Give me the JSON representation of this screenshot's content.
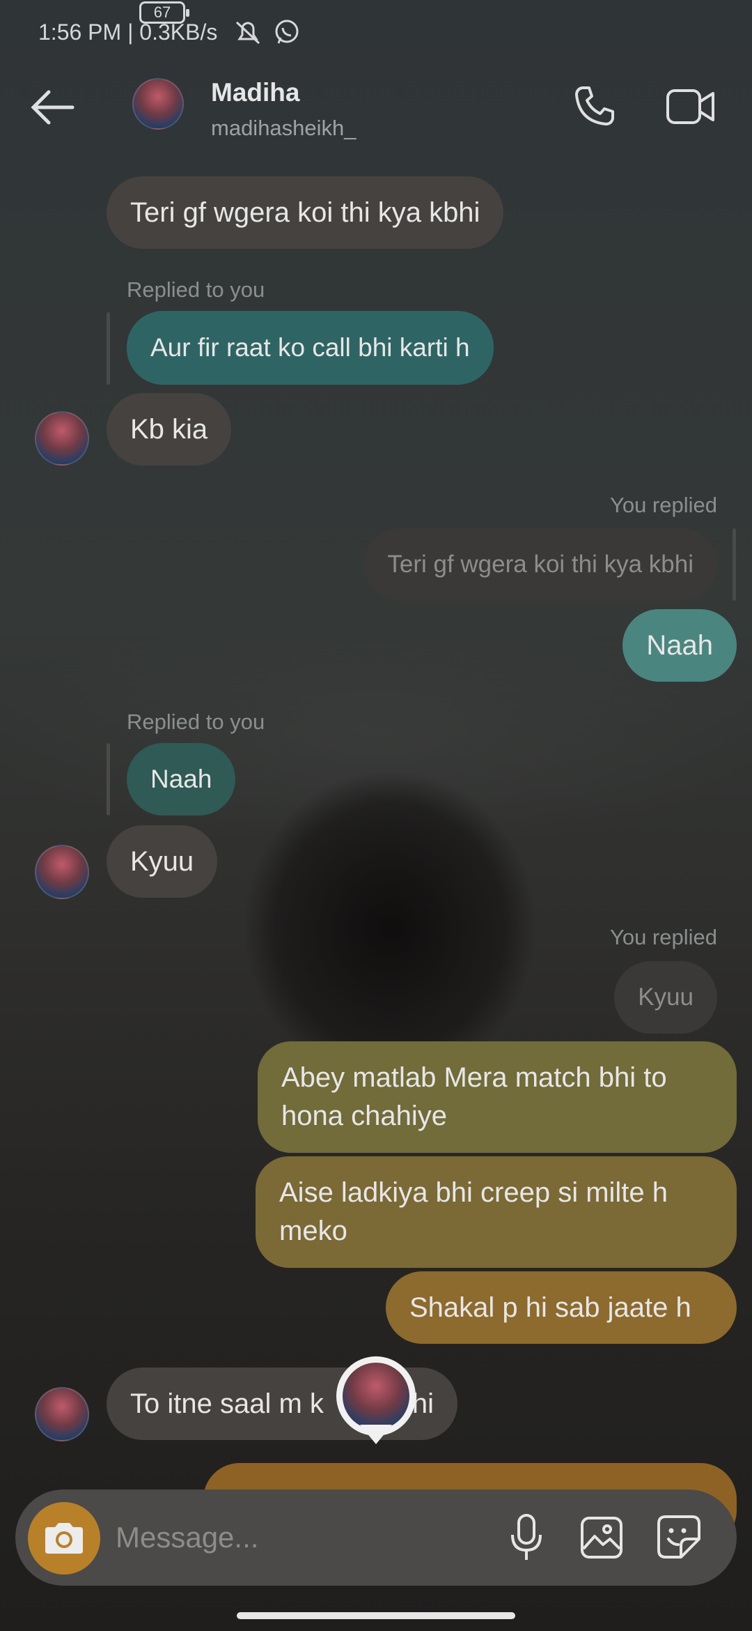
{
  "status_bar": {
    "time_speed": "1:56 PM | 0.3KB/s",
    "battery": "67"
  },
  "header": {
    "name": "Madiha",
    "username": "madihasheikh_"
  },
  "messages": [
    {
      "text": "Teri gf wgera koi thi kya kbhi"
    },
    {
      "meta": "Replied to you",
      "text": "Aur fir raat ko call bhi karti h"
    },
    {
      "text": "Kb kia"
    },
    {
      "meta": "You replied",
      "quoted": "Teri gf wgera koi thi kya kbhi"
    },
    {
      "text": "Naah"
    },
    {
      "meta": "Replied to you",
      "text": "Naah"
    },
    {
      "text": "Kyuu"
    },
    {
      "meta": "You replied",
      "quoted": "Kyuu"
    },
    {
      "text": "Abey matlab Mera match bhi to hona chahiye"
    },
    {
      "text": "Aise ladkiya bhi creep si milte h meko"
    },
    {
      "text": "Shakal p hi sab jaate h"
    },
    {
      "text": "To itne saal m k",
      "text_end": "hi"
    }
  ],
  "composer": {
    "placeholder": "Message..."
  },
  "colors": {
    "camera_button": "#b9802a",
    "outgoing_teal": "#4b8580",
    "outgoing_orange": "#8d6a2d"
  }
}
